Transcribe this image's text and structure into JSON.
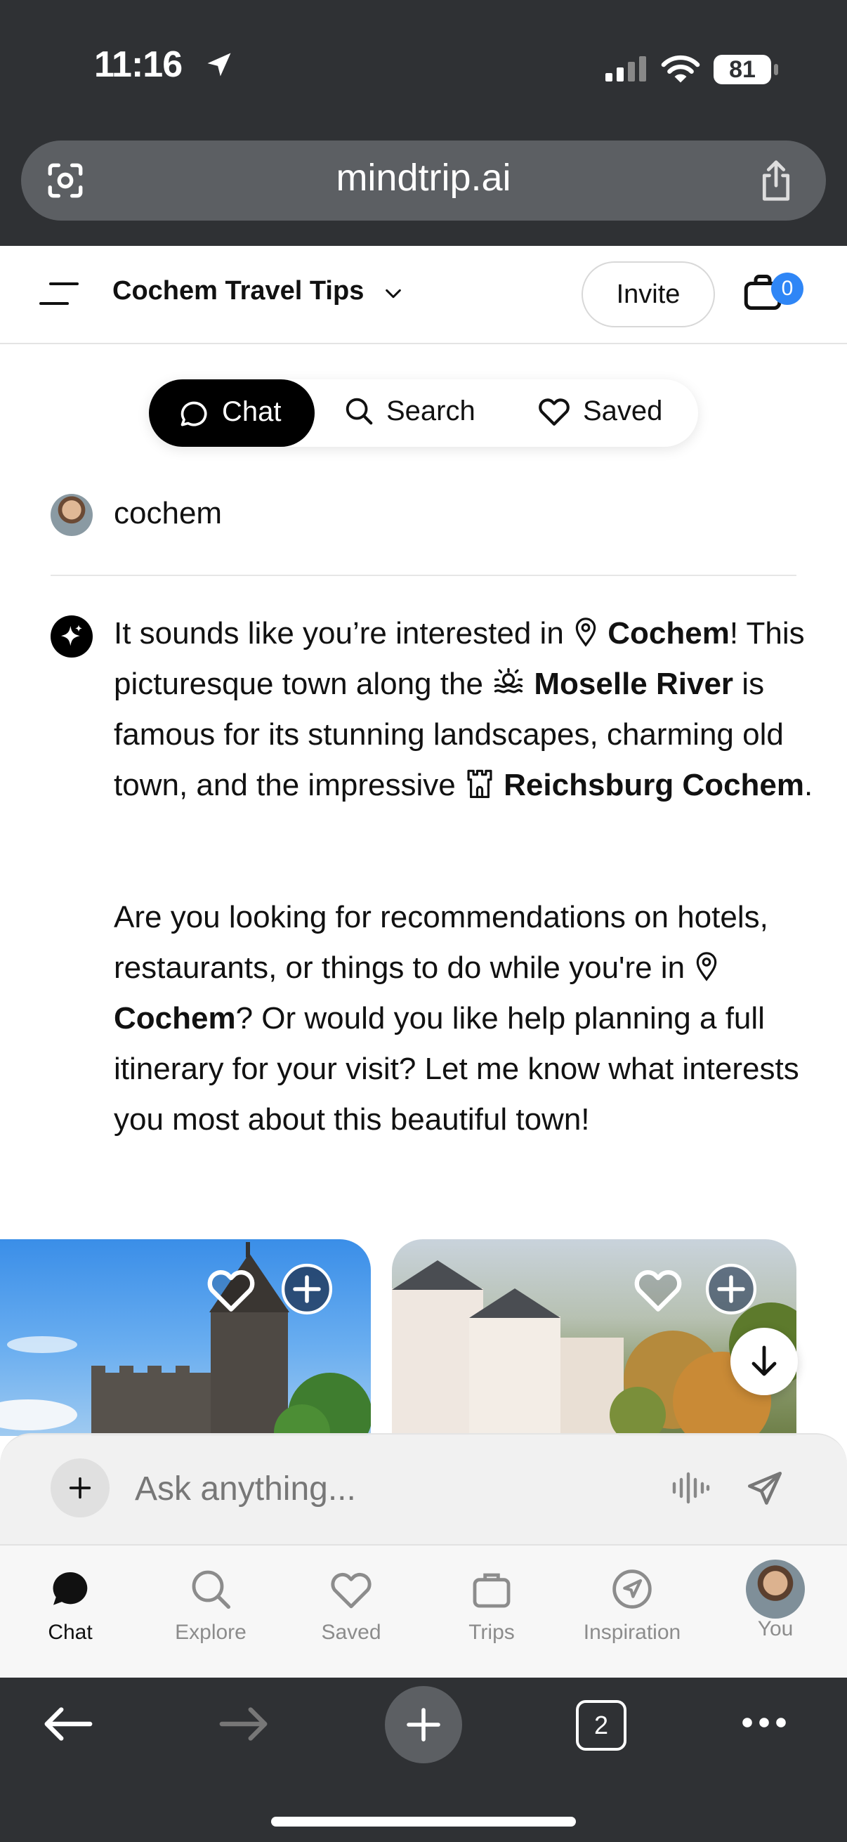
{
  "status_bar": {
    "time": "11:16",
    "battery": "81"
  },
  "browser": {
    "url": "mindtrip.ai",
    "tab_count": "2"
  },
  "header": {
    "title": "Cochem Travel Tips",
    "invite_label": "Invite",
    "cart_count": "0"
  },
  "segmented": {
    "chat": "Chat",
    "search": "Search",
    "saved": "Saved"
  },
  "conversation": {
    "user_query": "cochem",
    "p1": {
      "t1": "It sounds like you’re interested in ",
      "place1": "Cochem",
      "t2": "! This picturesque town along the ",
      "place2": "Moselle River",
      "t3": " is famous for its stunning landscapes, charming old town, and the impressive ",
      "place3": "Reichsburg Cochem",
      "t4": "."
    },
    "p2": {
      "t1": "Are you looking for recommendations on hotels, restaurants, or things to do while you're in ",
      "place1": "Cochem",
      "t2": "? Or would you like help planning a full itinerary for your visit? Let me know what interests you most about this beautiful town!"
    }
  },
  "composer": {
    "placeholder": "Ask anything..."
  },
  "tabbar": {
    "chat": "Chat",
    "explore": "Explore",
    "saved": "Saved",
    "trips": "Trips",
    "inspiration": "Inspiration",
    "you": "You"
  }
}
